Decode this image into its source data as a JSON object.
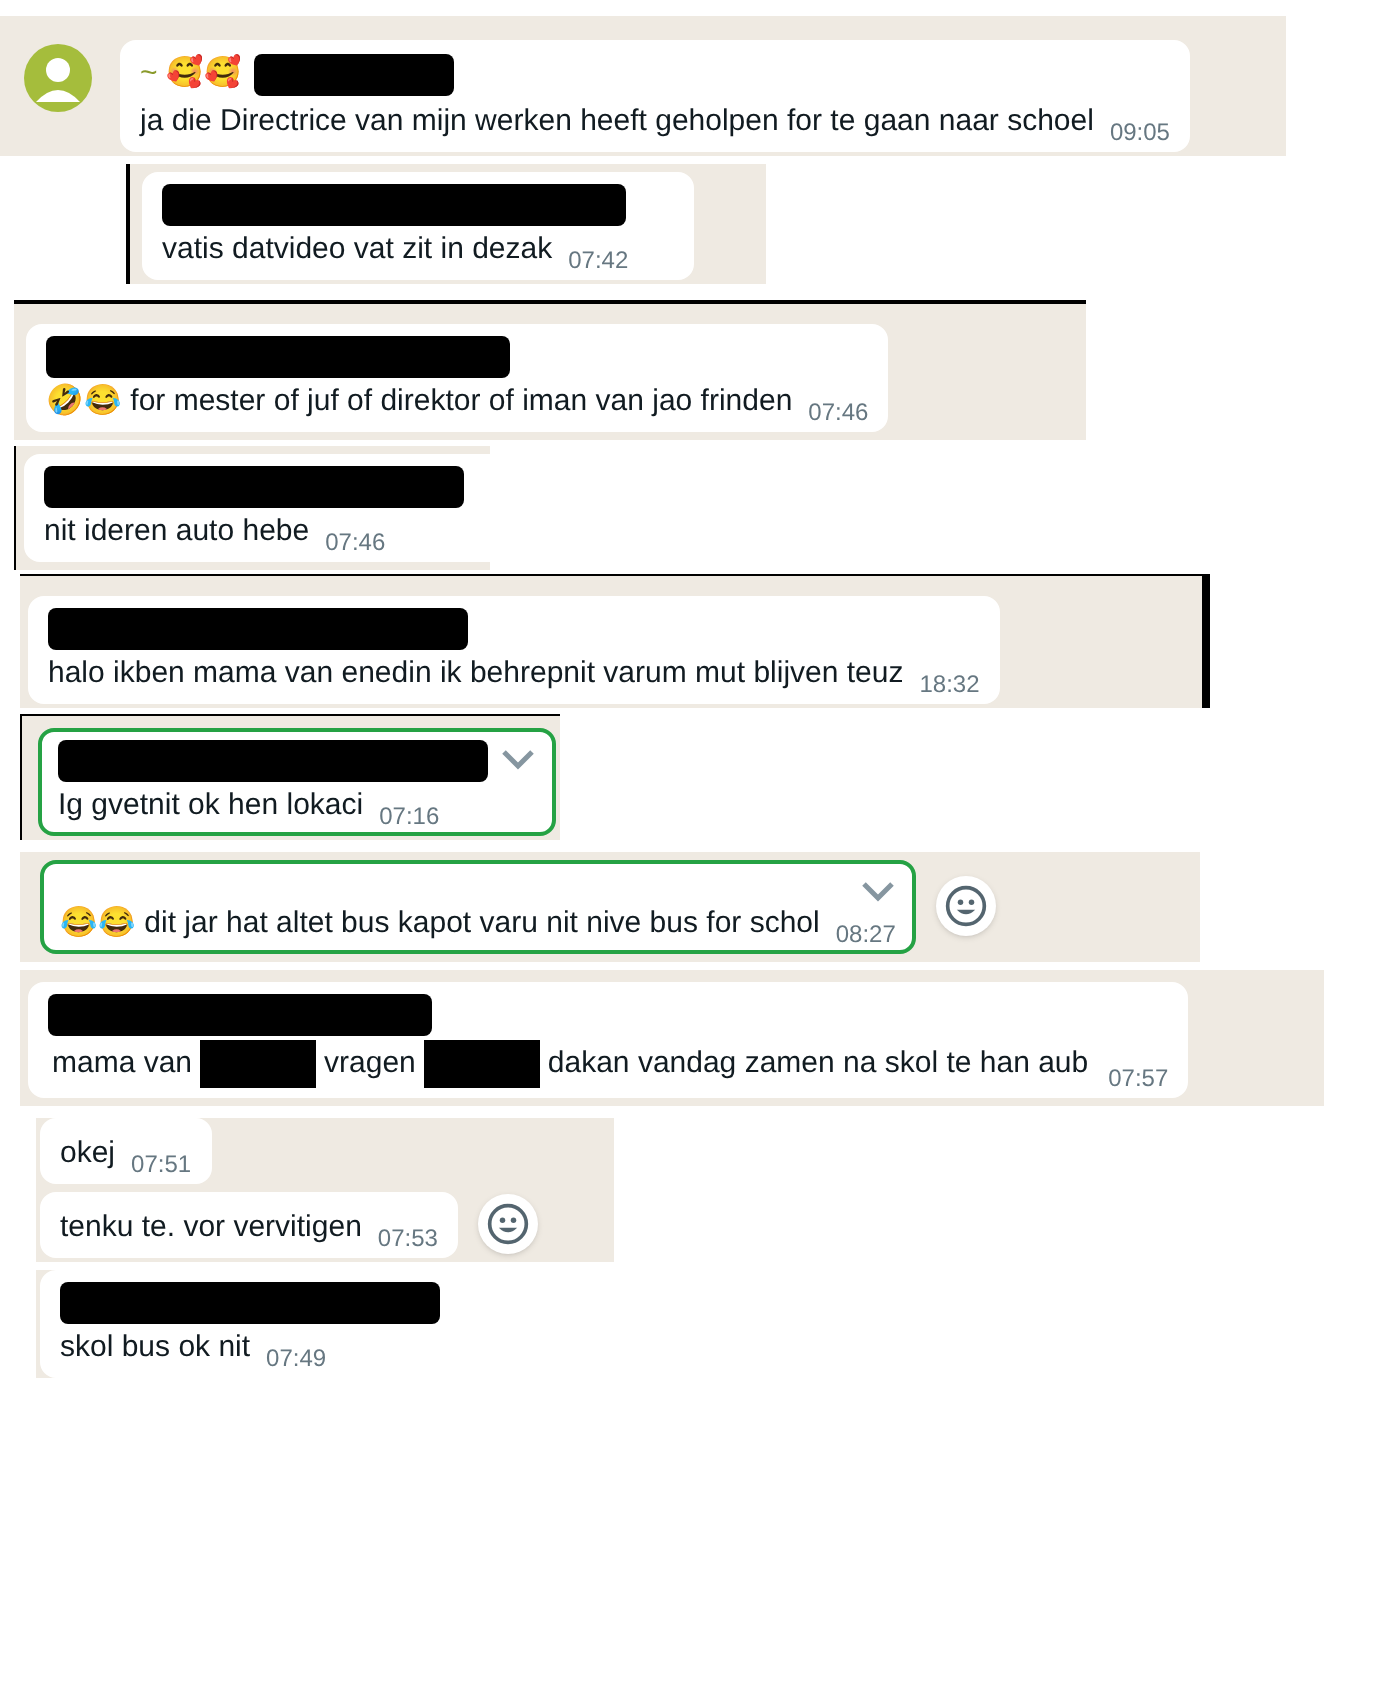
{
  "clips": [
    {
      "avatar": true,
      "messages": [
        {
          "sender": "~ 🥰🥰",
          "redacted_name": true,
          "text": "ja die  Directrice van mijn werken heeft geholpen for te gaan naar schoel",
          "time": "09:05",
          "outlined": false,
          "chevron": false,
          "reaction_button": false
        }
      ]
    },
    {
      "avatar": false,
      "messages": [
        {
          "redacted_name": true,
          "text": "vatis datvideo vat zit in dezak",
          "time": "07:42",
          "outlined": false,
          "chevron": false,
          "reaction_button": false
        }
      ]
    },
    {
      "avatar": false,
      "messages": [
        {
          "redacted_name": true,
          "text": "🤣😂 for mester of juf of direktor of iman van jao frinden",
          "time": "07:46",
          "outlined": false,
          "chevron": false,
          "reaction_button": false
        }
      ]
    },
    {
      "avatar": false,
      "messages": [
        {
          "redacted_name": true,
          "text": "nit ideren auto hebe",
          "time": "07:46",
          "outlined": false,
          "chevron": false,
          "reaction_button": false
        }
      ]
    },
    {
      "avatar": false,
      "messages": [
        {
          "redacted_name": true,
          "text": "halo ikben mama van enedin ik behrepnit varum mut blijven teuz",
          "time": "18:32",
          "outlined": false,
          "chevron": false,
          "reaction_button": false
        }
      ]
    },
    {
      "avatar": false,
      "messages": [
        {
          "redacted_name": true,
          "text": "Ig gvetnit ok hen lokaci",
          "time": "07:16",
          "outlined": true,
          "chevron": true,
          "reaction_button": false
        }
      ]
    },
    {
      "avatar": false,
      "messages": [
        {
          "redacted_name": false,
          "text": "😂😂 dit jar hat altet bus kapot varu nit nive bus for schol",
          "time": "08:27",
          "outlined": true,
          "chevron": true,
          "reaction_button": true
        }
      ]
    },
    {
      "avatar": false,
      "messages": [
        {
          "redacted_name": true,
          "parts": [
            {
              "kind": "text",
              "text": "mama van"
            },
            {
              "kind": "redacted"
            },
            {
              "kind": "text",
              "text": "vragen"
            },
            {
              "kind": "redacted"
            },
            {
              "kind": "text",
              "text": "dakan vandag zamen na skol te han aub"
            }
          ],
          "time": "07:57",
          "outlined": false,
          "chevron": false,
          "reaction_button": false
        }
      ]
    },
    {
      "avatar": false,
      "messages": [
        {
          "redacted_name": false,
          "text": "okej",
          "time": "07:51",
          "outlined": false,
          "chevron": false,
          "reaction_button": false
        },
        {
          "redacted_name": false,
          "text": "tenku te. vor vervitigen",
          "time": "07:53",
          "outlined": false,
          "chevron": false,
          "reaction_button": true
        }
      ]
    },
    {
      "avatar": false,
      "messages": [
        {
          "redacted_name": true,
          "text": "skol bus ok nit",
          "time": "07:49",
          "outlined": false,
          "chevron": false,
          "reaction_button": false
        }
      ]
    }
  ]
}
